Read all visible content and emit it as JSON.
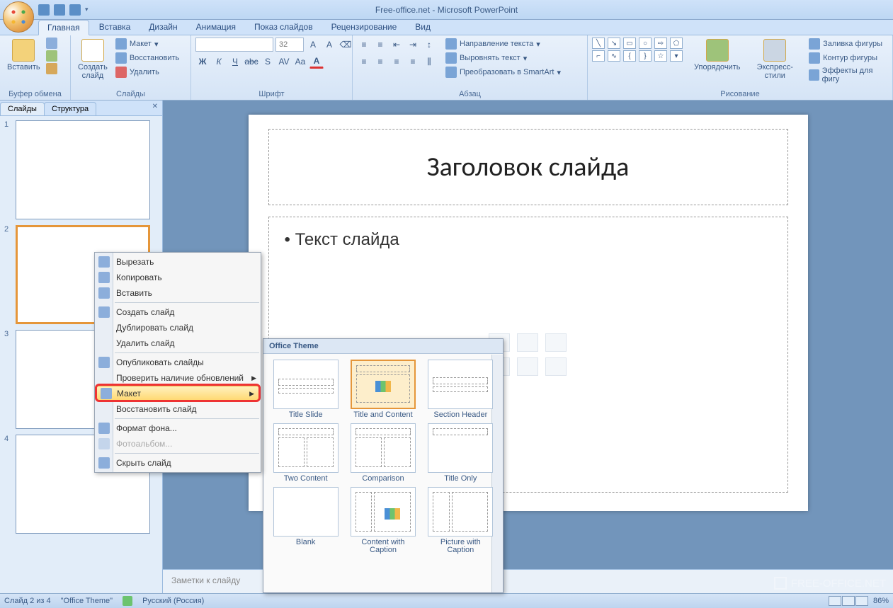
{
  "title": "Free-office.net - Microsoft PowerPoint",
  "tabs": {
    "home": "Главная",
    "insert": "Вставка",
    "design": "Дизайн",
    "animation": "Анимация",
    "slideshow": "Показ слайдов",
    "review": "Рецензирование",
    "view": "Вид"
  },
  "ribbon": {
    "clipboard": {
      "label": "Буфер обмена",
      "paste": "Вставить"
    },
    "slides": {
      "label": "Слайды",
      "new_slide": "Создать\nслайд",
      "layout": "Макет",
      "reset": "Восстановить",
      "delete": "Удалить"
    },
    "font": {
      "label": "Шрифт",
      "size": "32"
    },
    "paragraph": {
      "label": "Абзац",
      "text_dir": "Направление текста",
      "align": "Выровнять текст",
      "smartart": "Преобразовать в SmartArt"
    },
    "drawing": {
      "label": "Рисование",
      "arrange": "Упорядочить",
      "quickstyles": "Экспресс-стили",
      "fill": "Заливка фигуры",
      "outline": "Контур фигуры",
      "effects": "Эффекты для фигу"
    }
  },
  "panel": {
    "slides_tab": "Слайды",
    "outline_tab": "Структура"
  },
  "slide": {
    "title_ph": "Заголовок слайда",
    "body_ph": "Текст слайда"
  },
  "notes": "Заметки к слайду",
  "context": {
    "cut": "Вырезать",
    "copy": "Копировать",
    "paste": "Вставить",
    "new_slide": "Создать слайд",
    "duplicate": "Дублировать слайд",
    "delete": "Удалить слайд",
    "publish": "Опубликовать слайды",
    "check_updates": "Проверить наличие обновлений",
    "layout": "Макет",
    "reset": "Восстановить слайд",
    "format_bg": "Формат фона...",
    "photo": "Фотоальбом...",
    "hide": "Скрыть слайд"
  },
  "layouts": {
    "header": "Office Theme",
    "items": [
      "Title Slide",
      "Title and Content",
      "Section Header",
      "Two Content",
      "Comparison",
      "Title Only",
      "Blank",
      "Content with Caption",
      "Picture with Caption"
    ]
  },
  "status": {
    "slide_info": "Слайд 2 из 4",
    "theme": "\"Office Theme\"",
    "lang": "Русский (Россия)",
    "zoom": "86%"
  },
  "watermark": "FREE-OFFICE.NET"
}
